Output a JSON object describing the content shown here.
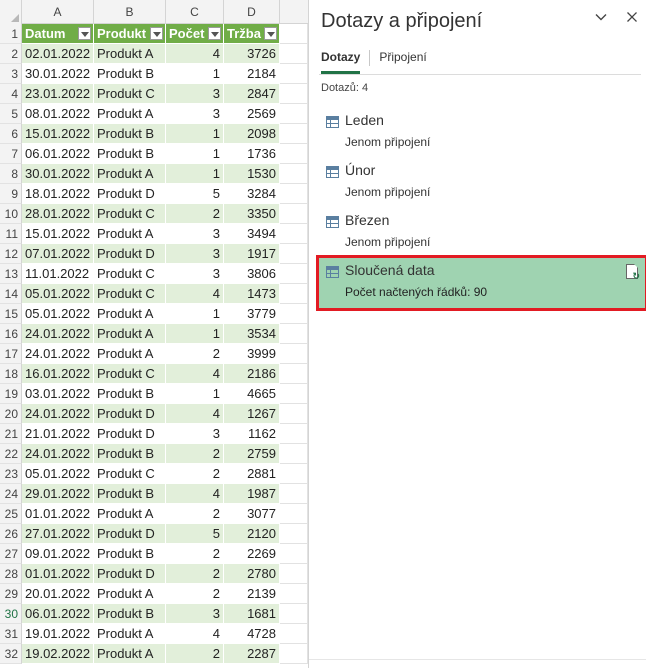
{
  "sheet": {
    "columns": [
      "A",
      "B",
      "C",
      "D"
    ],
    "headers": [
      "Datum",
      "Produkt",
      "Počet",
      "Tržba"
    ],
    "rows": [
      [
        "02.01.2022",
        "Produkt A",
        "4",
        "3726"
      ],
      [
        "30.01.2022",
        "Produkt B",
        "1",
        "2184"
      ],
      [
        "23.01.2022",
        "Produkt C",
        "3",
        "2847"
      ],
      [
        "08.01.2022",
        "Produkt A",
        "3",
        "2569"
      ],
      [
        "15.01.2022",
        "Produkt B",
        "1",
        "2098"
      ],
      [
        "06.01.2022",
        "Produkt B",
        "1",
        "1736"
      ],
      [
        "30.01.2022",
        "Produkt A",
        "1",
        "1530"
      ],
      [
        "18.01.2022",
        "Produkt D",
        "5",
        "3284"
      ],
      [
        "28.01.2022",
        "Produkt C",
        "2",
        "3350"
      ],
      [
        "15.01.2022",
        "Produkt A",
        "3",
        "3494"
      ],
      [
        "07.01.2022",
        "Produkt D",
        "3",
        "1917"
      ],
      [
        "11.01.2022",
        "Produkt C",
        "3",
        "3806"
      ],
      [
        "05.01.2022",
        "Produkt C",
        "4",
        "1473"
      ],
      [
        "05.01.2022",
        "Produkt A",
        "1",
        "3779"
      ],
      [
        "24.01.2022",
        "Produkt A",
        "1",
        "3534"
      ],
      [
        "24.01.2022",
        "Produkt A",
        "2",
        "3999"
      ],
      [
        "16.01.2022",
        "Produkt C",
        "4",
        "2186"
      ],
      [
        "03.01.2022",
        "Produkt B",
        "1",
        "4665"
      ],
      [
        "24.01.2022",
        "Produkt D",
        "4",
        "1267"
      ],
      [
        "21.01.2022",
        "Produkt D",
        "3",
        "1162"
      ],
      [
        "24.01.2022",
        "Produkt B",
        "2",
        "2759"
      ],
      [
        "05.01.2022",
        "Produkt C",
        "2",
        "2881"
      ],
      [
        "29.01.2022",
        "Produkt B",
        "4",
        "1987"
      ],
      [
        "01.01.2022",
        "Produkt A",
        "2",
        "3077"
      ],
      [
        "27.01.2022",
        "Produkt D",
        "5",
        "2120"
      ],
      [
        "09.01.2022",
        "Produkt B",
        "2",
        "2269"
      ],
      [
        "01.01.2022",
        "Produkt D",
        "2",
        "2780"
      ],
      [
        "20.01.2022",
        "Produkt A",
        "2",
        "2139"
      ],
      [
        "06.01.2022",
        "Produkt B",
        "3",
        "1681"
      ],
      [
        "19.01.2022",
        "Produkt A",
        "4",
        "4728"
      ],
      [
        "19.02.2022",
        "Produkt A",
        "2",
        "2287"
      ]
    ],
    "selected_row": 30
  },
  "pane": {
    "title": "Dotazy a připojení",
    "tabs": [
      "Dotazy",
      "Připojení"
    ],
    "active_tab": 0,
    "count_label": "Dotazů: 4",
    "queries": [
      {
        "name": "Leden",
        "status": "Jenom připojení",
        "icon": "table-icon"
      },
      {
        "name": "Únor",
        "status": "Jenom připojení",
        "icon": "table-icon"
      },
      {
        "name": "Březen",
        "status": "Jenom připojení",
        "icon": "table-icon"
      },
      {
        "name": "Sloučená data",
        "status": "Počet načtených řádků: 90",
        "icon": "table-icon",
        "selected": true
      }
    ]
  },
  "colors": {
    "header_green": "#70ad47",
    "band_green": "#e2efda",
    "selected_query": "#9fd3b1",
    "highlight_red": "#e21b23"
  }
}
